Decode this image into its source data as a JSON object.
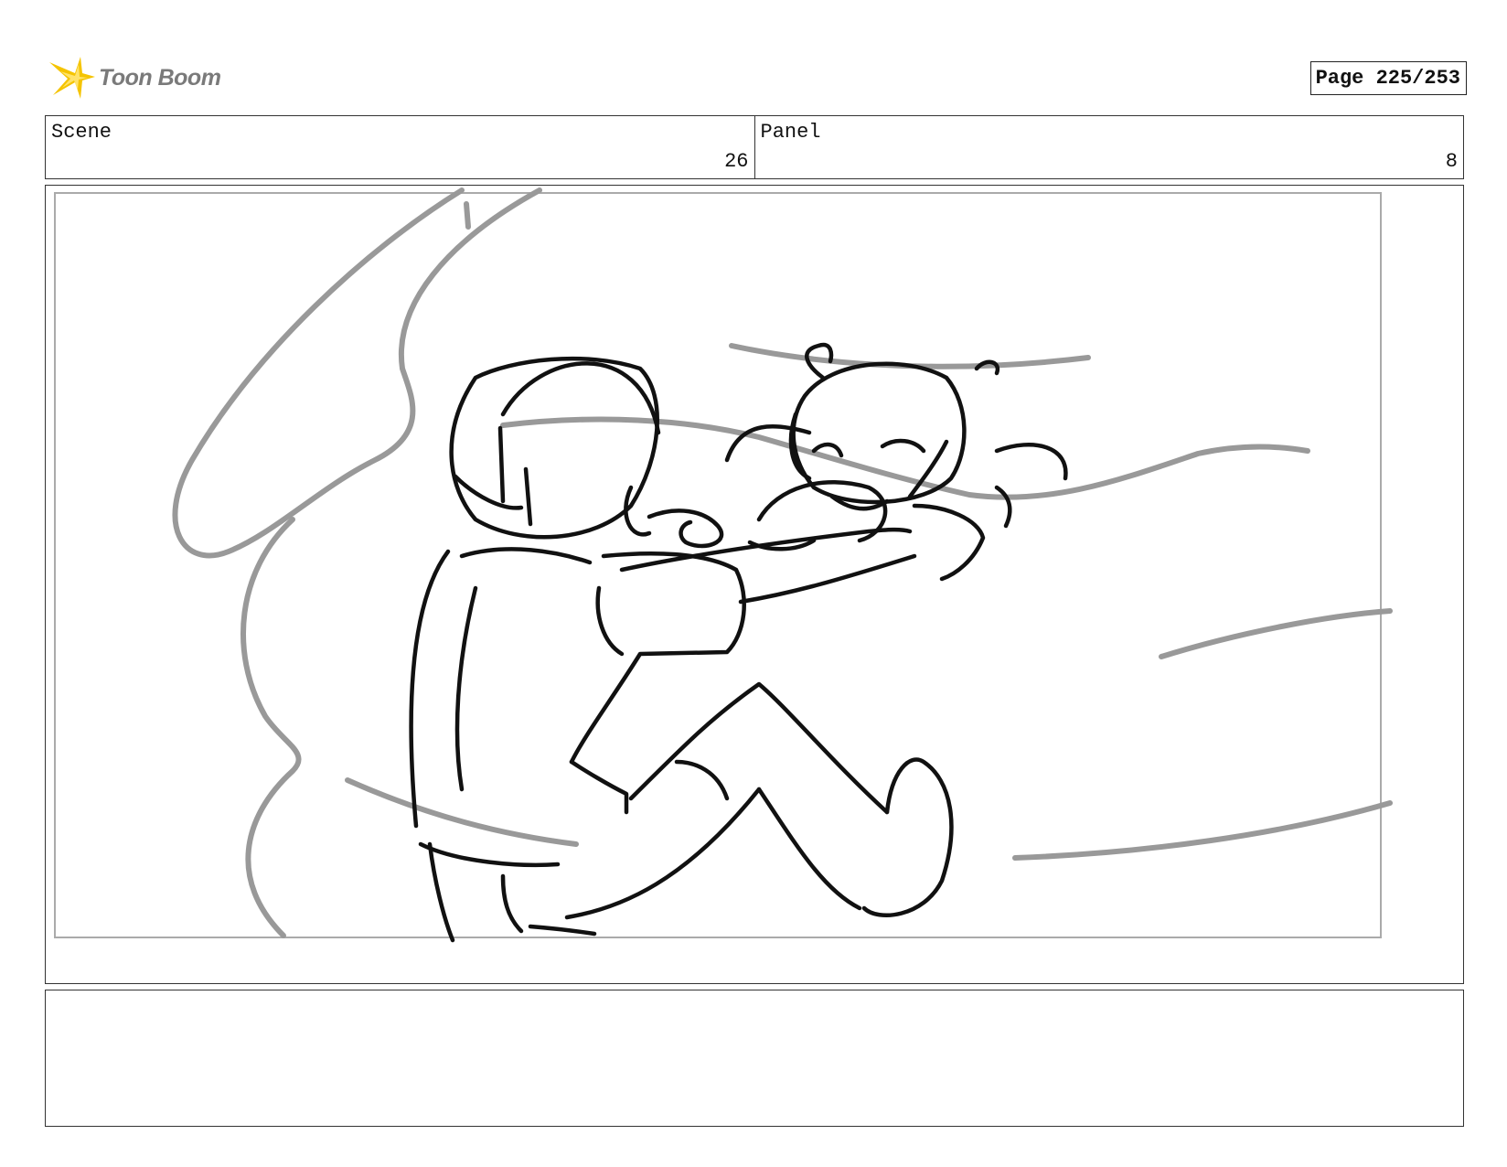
{
  "header": {
    "logo_text": "Toon Boom",
    "logo_icon": "toon-boom-star-icon",
    "page_label": "Page 225/253"
  },
  "info": {
    "scene_label": "Scene",
    "scene_value": "26",
    "panel_label": "Panel",
    "panel_value": "8"
  },
  "panel": {
    "image": "storyboard-sketch"
  },
  "notes": {
    "text": ""
  },
  "colors": {
    "logo_yellow": "#f5c400",
    "logo_text": "#7a7a7a",
    "sketch_ink": "#111111",
    "sketch_gray": "#999999"
  }
}
